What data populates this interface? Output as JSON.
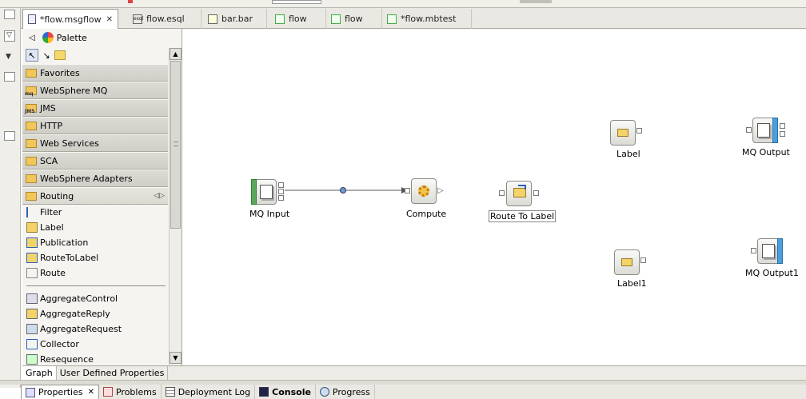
{
  "editor_tabs": [
    {
      "label": "*flow.msgflow",
      "icon": "msgflow-icon",
      "active": true,
      "closable": true
    },
    {
      "label": "flow.esql",
      "icon": "esql-icon"
    },
    {
      "label": "bar.bar",
      "icon": "bar-file-icon"
    },
    {
      "label": "flow",
      "icon": "document-icon"
    },
    {
      "label": "flow",
      "icon": "document-icon"
    },
    {
      "label": "*flow.mbtest",
      "icon": "document-icon"
    }
  ],
  "palette": {
    "title": "Palette",
    "drawers": [
      {
        "label": "Favorites"
      },
      {
        "label": "WebSphere MQ"
      },
      {
        "label": "JMS"
      },
      {
        "label": "HTTP"
      },
      {
        "label": "Web Services"
      },
      {
        "label": "SCA"
      },
      {
        "label": "WebSphere Adapters"
      },
      {
        "label": "Routing"
      }
    ],
    "routing_entries": [
      "Filter",
      "Label",
      "Publication",
      "RouteToLabel",
      "Route"
    ],
    "aggregate_entries": [
      "AggregateControl",
      "AggregateReply",
      "AggregateRequest",
      "Collector",
      "Resequence"
    ]
  },
  "canvas": {
    "nodes": [
      {
        "label": "MQ Input",
        "icon": "mq-input-icon"
      },
      {
        "label": "Compute",
        "icon": "compute-gears-icon"
      },
      {
        "label": "Route To Label",
        "icon": "route-to-label-icon",
        "selected": true
      },
      {
        "label": "Label",
        "icon": "label-icon"
      },
      {
        "label": "MQ Output",
        "icon": "mq-output-icon"
      },
      {
        "label": "Label1",
        "icon": "label-icon"
      },
      {
        "label": "MQ Output1",
        "icon": "mq-output-icon"
      }
    ]
  },
  "editor_bottom_tabs": [
    {
      "label": "Graph",
      "active": true
    },
    {
      "label": "User Defined Properties"
    }
  ],
  "view_tabs": [
    {
      "label": "Properties",
      "icon": "properties-icon",
      "active": true,
      "closable": true
    },
    {
      "label": "Problems",
      "icon": "problems-icon"
    },
    {
      "label": "Deployment Log",
      "icon": "table-icon"
    },
    {
      "label": "Console",
      "icon": "console-icon",
      "bold": true
    },
    {
      "label": "Progress",
      "icon": "progress-icon"
    }
  ],
  "colors": {
    "mq_green": "#5aa85a",
    "mq_blue": "#4a9fe0",
    "connection": "#555555"
  }
}
